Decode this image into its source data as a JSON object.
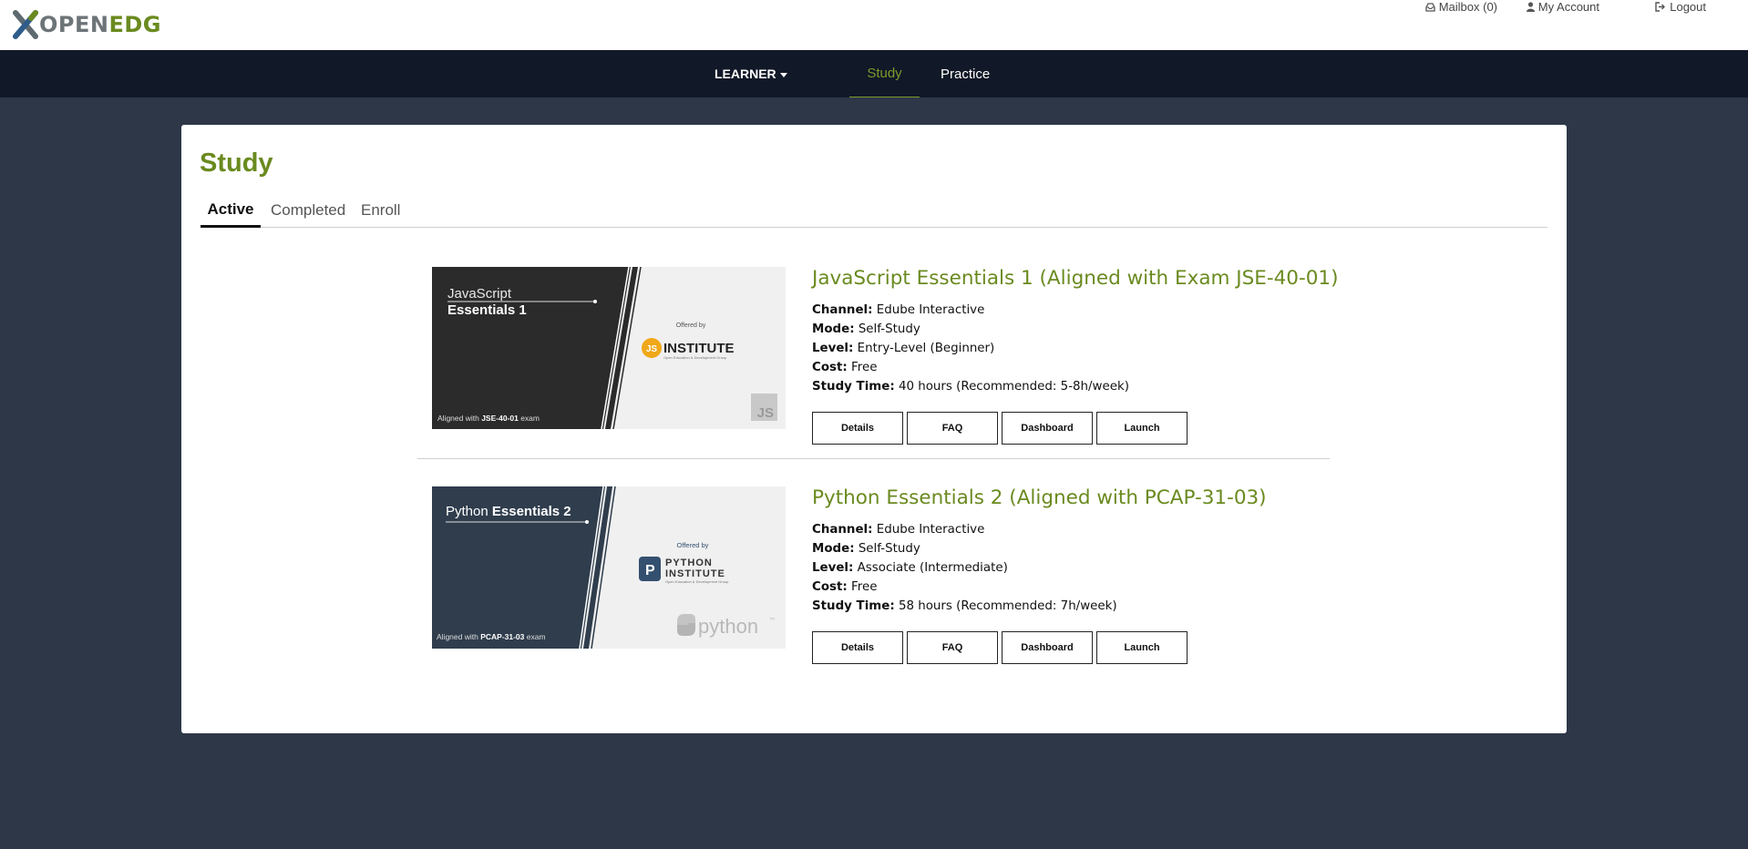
{
  "header": {
    "logo_open": "OPEN",
    "logo_edg": "EDG",
    "mailbox_label": "Mailbox (0)",
    "account_label": "My Account",
    "logout_label": "Logout"
  },
  "nav": {
    "learner_label": "LEARNER",
    "study_label": "Study",
    "practice_label": "Practice"
  },
  "page": {
    "title": "Study",
    "tabs": [
      {
        "label": "Active",
        "active": true
      },
      {
        "label": "Completed",
        "active": false
      },
      {
        "label": "Enroll",
        "active": false
      }
    ]
  },
  "courses": [
    {
      "title": "JavaScript Essentials 1 (Aligned with Exam JSE-40-01)",
      "channel_label": "Channel:",
      "channel": "Edube Interactive",
      "mode_label": "Mode:",
      "mode": "Self-Study",
      "level_label": "Level:",
      "level": "Entry-Level (Beginner)",
      "cost_label": "Cost:",
      "cost": "Free",
      "time_label": "Study Time:",
      "time": "40 hours (Recommended: 5-8h/week)",
      "thumb": {
        "line1": "JavaScript",
        "line2": "Essentials 1",
        "aligned_prefix": "Aligned with ",
        "exam_code": "JSE-40-01",
        "aligned_suffix": " exam",
        "offered_by": "Offered by",
        "badge": "JS",
        "institute": "INSTITUTE",
        "institute_sub": "Open Education & Development Group",
        "corner": "JS"
      },
      "buttons": {
        "details": "Details",
        "faq": "FAQ",
        "dashboard": "Dashboard",
        "launch": "Launch"
      }
    },
    {
      "title": "Python Essentials 2 (Aligned with PCAP-31-03)",
      "channel_label": "Channel:",
      "channel": "Edube Interactive",
      "mode_label": "Mode:",
      "mode": "Self-Study",
      "level_label": "Level:",
      "level": "Associate (Intermediate)",
      "cost_label": "Cost:",
      "cost": "Free",
      "time_label": "Study Time:",
      "time": "58 hours (Recommended: 7h/week)",
      "thumb": {
        "line1": "Python",
        "line2": "Essentials 2",
        "aligned_prefix": "Aligned with ",
        "exam_code": "PCAP-31-03",
        "aligned_suffix": " exam",
        "offered_by": "Offered by",
        "institute_l1": "PYTHON",
        "institute_l2": "INSTITUTE",
        "institute_sub": "Open Education & Development Group",
        "python_word": "python",
        "tm": "™"
      },
      "buttons": {
        "details": "Details",
        "faq": "FAQ",
        "dashboard": "Dashboard",
        "launch": "Launch"
      }
    }
  ],
  "colors": {
    "brand_green": "#6a8a1f",
    "page_bg": "#2d3748",
    "nav_bg": "#111827",
    "js_thumb_dark": "#2b2b2b",
    "py_thumb_dark": "#2f3d4d",
    "js_badge": "#f0a818",
    "py_badge": "#34506f"
  },
  "icons": [
    "openedg-logo-icon",
    "inbox-icon",
    "user-icon",
    "logout-icon",
    "caret-down-icon"
  ]
}
